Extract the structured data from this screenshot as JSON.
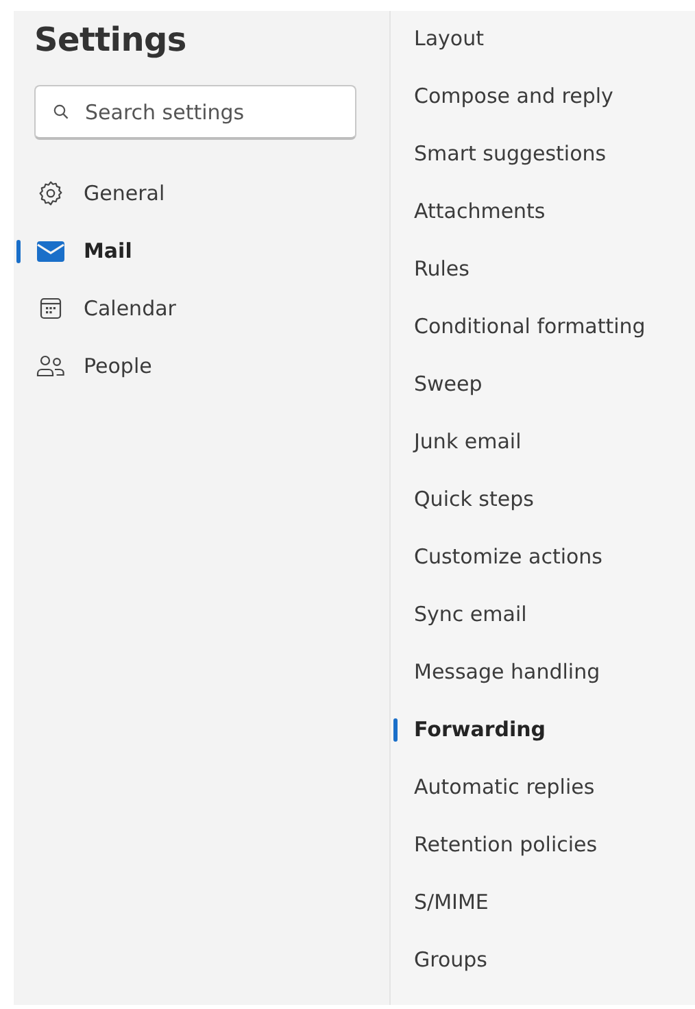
{
  "title": "Settings",
  "search": {
    "placeholder": "Search settings"
  },
  "categories": [
    {
      "label": "General",
      "kind": "gear",
      "selected": false
    },
    {
      "label": "Mail",
      "kind": "mail",
      "selected": true
    },
    {
      "label": "Calendar",
      "kind": "calendar",
      "selected": false
    },
    {
      "label": "People",
      "kind": "people",
      "selected": false
    }
  ],
  "subsections": [
    {
      "label": "Layout",
      "selected": false
    },
    {
      "label": "Compose and reply",
      "selected": false
    },
    {
      "label": "Smart suggestions",
      "selected": false
    },
    {
      "label": "Attachments",
      "selected": false
    },
    {
      "label": "Rules",
      "selected": false
    },
    {
      "label": "Conditional formatting",
      "selected": false
    },
    {
      "label": "Sweep",
      "selected": false
    },
    {
      "label": "Junk email",
      "selected": false
    },
    {
      "label": "Quick steps",
      "selected": false
    },
    {
      "label": "Customize actions",
      "selected": false
    },
    {
      "label": "Sync email",
      "selected": false
    },
    {
      "label": "Message handling",
      "selected": false
    },
    {
      "label": "Forwarding",
      "selected": true
    },
    {
      "label": "Automatic replies",
      "selected": false
    },
    {
      "label": "Retention policies",
      "selected": false
    },
    {
      "label": "S/MIME",
      "selected": false
    },
    {
      "label": "Groups",
      "selected": false
    }
  ]
}
